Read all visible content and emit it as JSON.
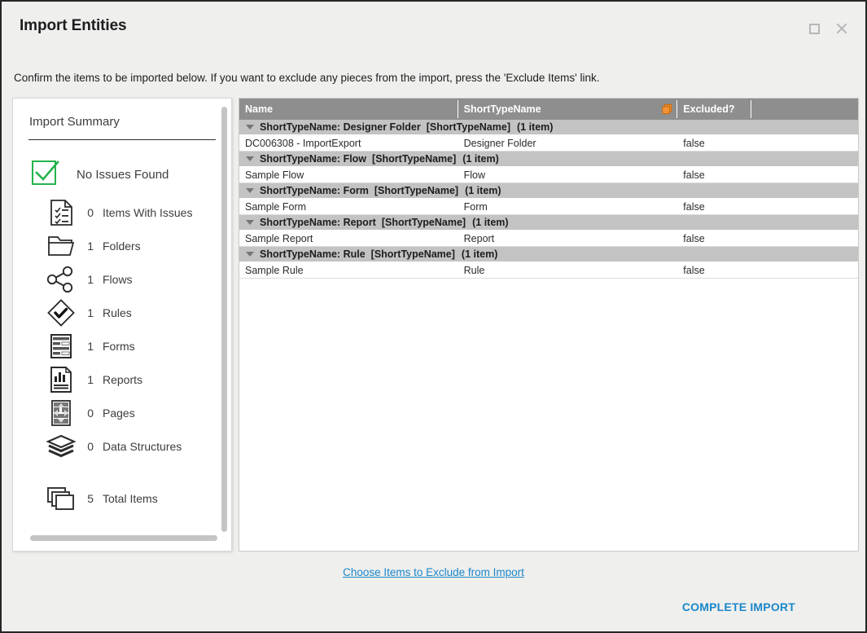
{
  "window": {
    "title": "Import Entities",
    "maximize_icon": "maximize-icon",
    "close_icon": "close-icon"
  },
  "instruction": "Confirm the items to be imported below. If you want to exclude any pieces from the import, press the 'Exclude Items' link.",
  "summary": {
    "title": "Import Summary",
    "status_label": "No Issues Found",
    "status_icon": "green-check-box-icon",
    "status_color": "#25b24c",
    "stats": [
      {
        "count": "0",
        "label": "Items With Issues",
        "icon": "checklist-document-icon"
      },
      {
        "count": "1",
        "label": "Folders",
        "icon": "folder-icon"
      },
      {
        "count": "1",
        "label": "Flows",
        "icon": "share-nodes-icon"
      },
      {
        "count": "1",
        "label": "Rules",
        "icon": "diamond-check-icon"
      },
      {
        "count": "1",
        "label": "Forms",
        "icon": "form-layout-icon"
      },
      {
        "count": "1",
        "label": "Reports",
        "icon": "report-chart-document-icon"
      },
      {
        "count": "0",
        "label": "Pages",
        "icon": "page-layout-icon"
      },
      {
        "count": "0",
        "label": "Data Structures",
        "icon": "layers-stack-icon"
      },
      {
        "count": "5",
        "label": "Total Items",
        "icon": "stacked-cards-icon"
      }
    ]
  },
  "grid": {
    "columns": [
      {
        "label": "Name"
      },
      {
        "label": "ShortTypeName",
        "icon": "orange-copy-icon"
      },
      {
        "label": "Excluded?"
      },
      {
        "label": ""
      }
    ],
    "groups": [
      {
        "header_prefix": "ShortTypeName: Designer Folder",
        "header_field": "[ShortTypeName]",
        "header_count": "(1 item)",
        "rows": [
          {
            "name": "DC006308 - ImportExport",
            "type": "Designer Folder",
            "excluded": "false"
          }
        ]
      },
      {
        "header_prefix": "ShortTypeName: Flow",
        "header_field": "[ShortTypeName]",
        "header_count": "(1 item)",
        "rows": [
          {
            "name": "Sample Flow",
            "type": "Flow",
            "excluded": "false"
          }
        ]
      },
      {
        "header_prefix": "ShortTypeName: Form",
        "header_field": "[ShortTypeName]",
        "header_count": "(1 item)",
        "rows": [
          {
            "name": "Sample Form",
            "type": "Form",
            "excluded": "false"
          }
        ]
      },
      {
        "header_prefix": "ShortTypeName: Report",
        "header_field": "[ShortTypeName]",
        "header_count": "(1 item)",
        "rows": [
          {
            "name": "Sample Report",
            "type": "Report",
            "excluded": "false"
          }
        ]
      },
      {
        "header_prefix": "ShortTypeName: Rule",
        "header_field": "[ShortTypeName]",
        "header_count": "(1 item)",
        "rows": [
          {
            "name": "Sample Rule",
            "type": "Rule",
            "excluded": "false"
          }
        ]
      }
    ]
  },
  "footer": {
    "exclude_link": "Choose Items to Exclude from Import",
    "complete_button": "COMPLETE IMPORT",
    "link_color": "#1b87c9"
  }
}
